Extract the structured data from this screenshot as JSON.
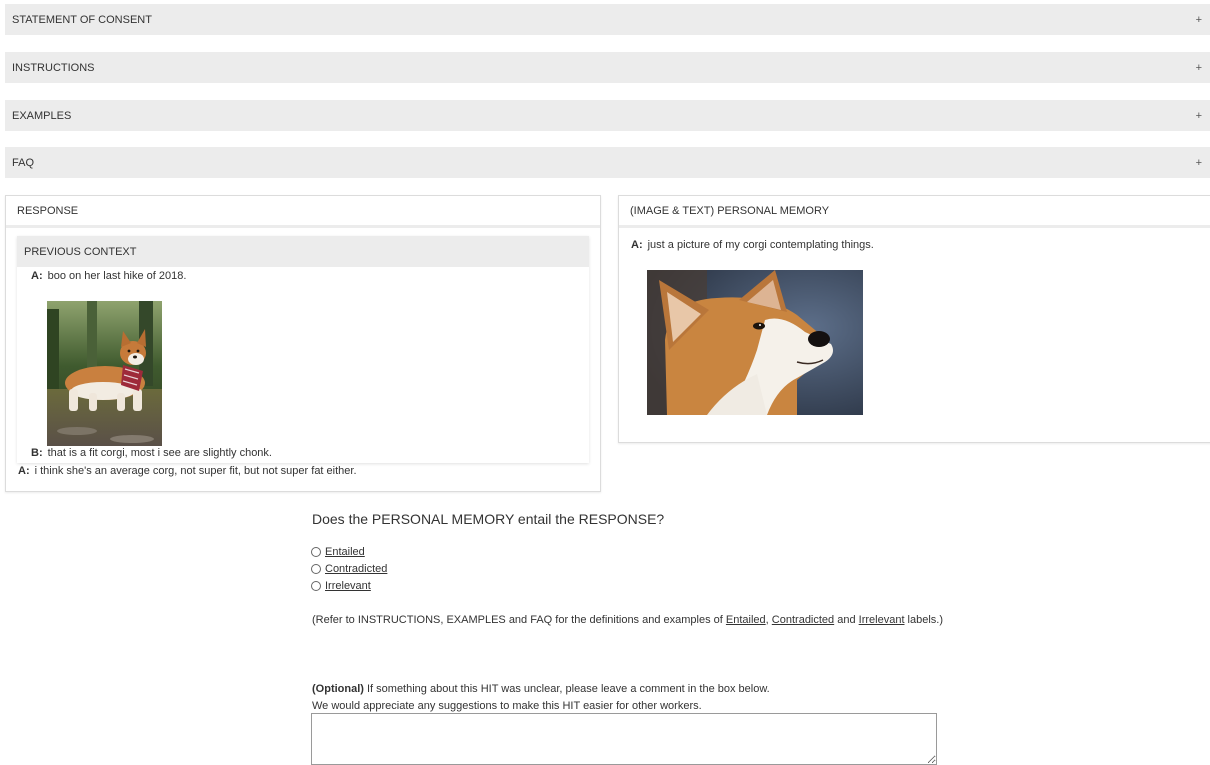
{
  "accordions": [
    {
      "label": "STATEMENT OF CONSENT",
      "icon": "+"
    },
    {
      "label": "INSTRUCTIONS",
      "icon": "+"
    },
    {
      "label": "EXAMPLES",
      "icon": "+"
    },
    {
      "label": "FAQ",
      "icon": "+"
    }
  ],
  "response_panel": {
    "title": "RESPONSE",
    "previous_context": {
      "title": "PREVIOUS CONTEXT",
      "utterances": [
        {
          "speaker": "A:",
          "text": "boo on her last hike of 2018."
        },
        {
          "speaker": "B:",
          "text": "that is a fit corgi, most i see are slightly chonk."
        }
      ]
    },
    "response": {
      "speaker": "A:",
      "text": "i think she's an average corg, not super fit, but not super fat either."
    }
  },
  "memory_panel": {
    "title": "(IMAGE & TEXT) PERSONAL MEMORY",
    "speaker": "A:",
    "text": "just a picture of my corgi contemplating things."
  },
  "question": {
    "text": "Does the PERSONAL MEMORY entail the RESPONSE?",
    "options": [
      "Entailed",
      "Contradicted",
      "Irrelevant"
    ],
    "note_prefix": "(Refer to INSTRUCTIONS, EXAMPLES and FAQ for the definitions and examples of ",
    "note_sep1": ", ",
    "note_sep2": " and ",
    "note_suffix": " labels.)"
  },
  "comment": {
    "optional_label": "(Optional)",
    "line1": " If something about this HIT was unclear, please leave a comment in the box below.",
    "line2": "We would appreciate any suggestions to make this HIT easier for other workers.",
    "value": ""
  }
}
